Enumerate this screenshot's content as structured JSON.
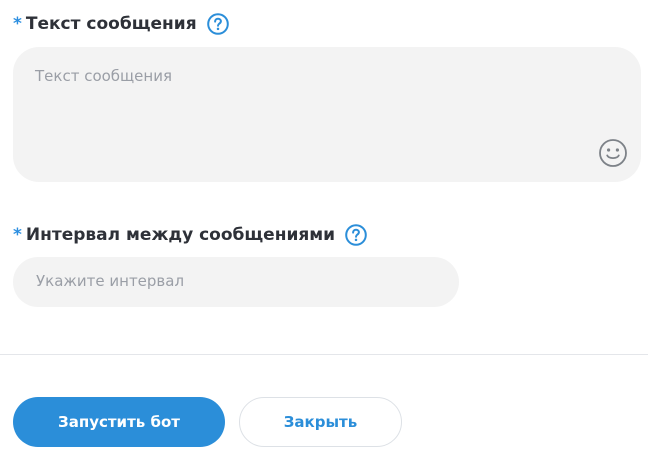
{
  "message_field": {
    "required_mark": "*",
    "label": "Текст сообщения",
    "placeholder": "Текст сообщения",
    "help_icon": "question-circle-icon",
    "emoji_icon": "smiley-face-icon"
  },
  "interval_field": {
    "required_mark": "*",
    "label": "Интервал между сообщениями",
    "placeholder": "Укажите интервал",
    "help_icon": "question-circle-icon"
  },
  "actions": {
    "start_label": "Запустить бот",
    "close_label": "Закрыть"
  },
  "colors": {
    "accent": "#2b8ed9",
    "field_background": "#f3f3f3",
    "placeholder_text": "#9a9ea6",
    "divider": "#e4e6ea"
  }
}
